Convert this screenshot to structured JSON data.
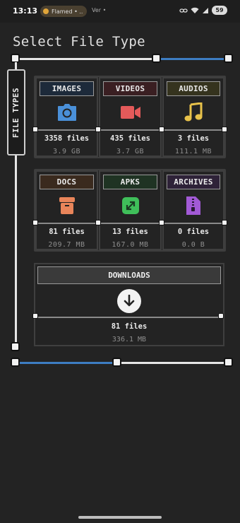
{
  "status_bar": {
    "time": "13:13",
    "pill_text": "Flamed • ..",
    "extra": "Ver •"
  },
  "title": "Select File Type",
  "side_label": "FILE TYPES",
  "categories": [
    {
      "label": "IMAGES",
      "files": "3358 files",
      "size": "3.9 GB",
      "icon": "camera-icon",
      "label_bg": "#1d2a3a",
      "icon_color": "#4a90d9"
    },
    {
      "label": "VIDEOS",
      "files": "435 files",
      "size": "3.7 GB",
      "icon": "video-camera-icon",
      "label_bg": "#3a1f22",
      "icon_color": "#e45a5a"
    },
    {
      "label": "AUDIOS",
      "files": "3 files",
      "size": "111.1 MB",
      "icon": "music-note-icon",
      "label_bg": "#35331e",
      "icon_color": "#e8c24a"
    },
    {
      "label": "DOCS",
      "files": "81 files",
      "size": "209.7 MB",
      "icon": "document-box-icon",
      "label_bg": "#3a2a1e",
      "icon_color": "#e9855a"
    },
    {
      "label": "APKS",
      "files": "13 files",
      "size": "167.0 MB",
      "icon": "android-package-icon",
      "label_bg": "#1f3323",
      "icon_color": "#3fbf5a"
    },
    {
      "label": "ARCHIVES",
      "files": "0 files",
      "size": "0.0 B",
      "icon": "zip-file-icon",
      "label_bg": "#2e2238",
      "icon_color": "#a25ad6"
    }
  ],
  "downloads": {
    "label": "DOWNLOADS",
    "files": "81 files",
    "size": "336.1 MB",
    "icon": "download-arrow-icon"
  },
  "sliders": {
    "top_blue_fraction": 0.33,
    "bottom_blue_fraction": 0.47,
    "accent": "#3d7dc2"
  }
}
